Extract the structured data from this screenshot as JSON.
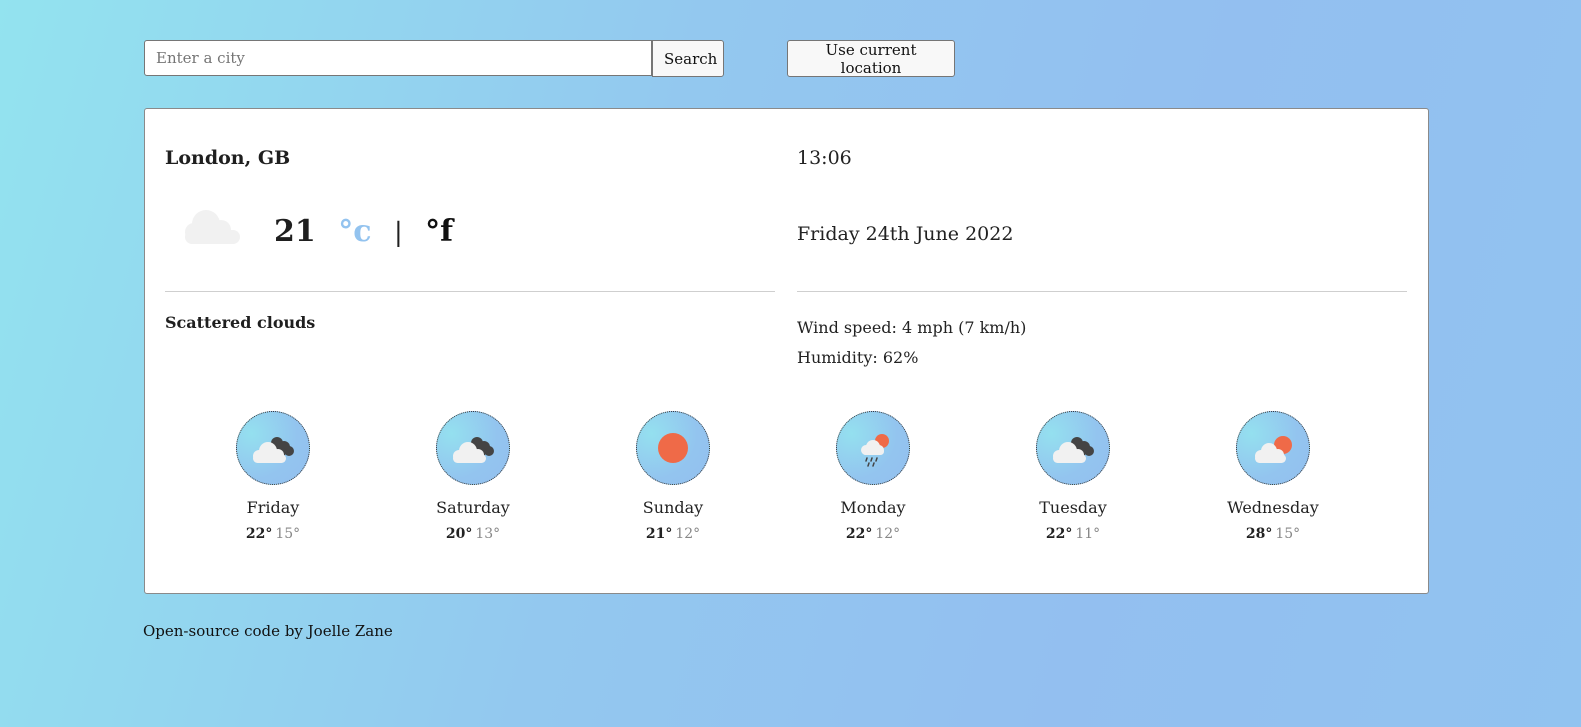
{
  "search": {
    "placeholder": "Enter a city",
    "value": "",
    "search_label": "Search",
    "location_label": "Use current location"
  },
  "current": {
    "city": "London, GB",
    "time": "13:06",
    "temperature": "21",
    "unit_celsius": "°c",
    "unit_separator": "|",
    "unit_fahrenheit": "°f",
    "active_unit": "celsius",
    "icon": "cloud-icon",
    "date": "Friday 24th June 2022",
    "description": "Scattered clouds",
    "wind": "Wind speed: 4 mph (7 km/h)",
    "humidity": "Humidity: 62%"
  },
  "forecast": [
    {
      "day": "Friday",
      "high": "22°",
      "low": "15°",
      "icon": "broken-clouds-icon"
    },
    {
      "day": "Saturday",
      "high": "20°",
      "low": "13°",
      "icon": "broken-clouds-icon"
    },
    {
      "day": "Sunday",
      "high": "21°",
      "low": "12°",
      "icon": "sun-icon"
    },
    {
      "day": "Monday",
      "high": "22°",
      "low": "12°",
      "icon": "rain-sun-cloud-icon"
    },
    {
      "day": "Tuesday",
      "high": "22°",
      "low": "11°",
      "icon": "broken-clouds-icon"
    },
    {
      "day": "Wednesday",
      "high": "28°",
      "low": "15°",
      "icon": "sun-cloud-icon"
    }
  ],
  "footer": {
    "link_text": "Open-source code",
    "by_text": "by",
    "author": "Joelle Zane"
  },
  "colors": {
    "accent": "#93c3ef",
    "sun": "#ef6a48",
    "dark_cloud": "#444444",
    "light_cloud": "#f1f1f1"
  }
}
